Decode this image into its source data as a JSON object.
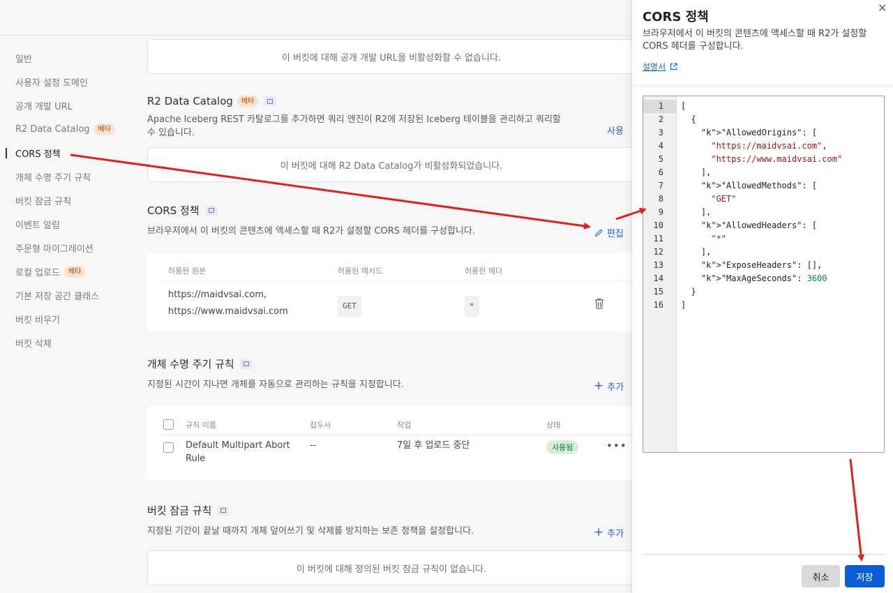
{
  "nav": {
    "items": [
      {
        "label": "일반"
      },
      {
        "label": "사용자 설정 도메인"
      },
      {
        "label": "공개 개발 URL"
      },
      {
        "label": "R2 Data Catalog",
        "badge": "베타"
      },
      {
        "label": "CORS 정책",
        "active": true
      },
      {
        "label": "개체 수명 주기 규칙"
      },
      {
        "label": "버킷 잠금 규칙"
      },
      {
        "label": "이벤트 알림"
      },
      {
        "label": "주문형 마이그레이션"
      },
      {
        "label": "로컬 업로드",
        "badge": "베타"
      },
      {
        "label": "기본 저장 공간 클래스"
      },
      {
        "label": "버킷 비우기"
      },
      {
        "label": "버킷 삭제"
      }
    ]
  },
  "main": {
    "public_url_box": "이 버킷에 대해 공개 개발 URL을 비활성화할 수 없습니다.",
    "catalog": {
      "title": "R2 Data Catalog",
      "badge": "베타",
      "desc_line1": "Apache Iceberg REST 카탈로그를 추가하면 쿼리 엔진이 R2에 저장된 Iceberg 테이블을 관리하고 쿼리할",
      "desc_line2": "수 있습니다.",
      "action": "사용",
      "empty": "이 버킷에 대해 R2 Data Catalog가 비활성화되었습니다."
    },
    "cors": {
      "title": "CORS 정책",
      "desc": "브라우저에서 이 버킷의 콘텐츠에 액세스할 때 R2가 설정할 CORS 헤더를 구성합니다.",
      "edit": "편집",
      "headers": [
        "허용된 원본",
        "허용된 메서드",
        "허용된 헤더"
      ],
      "row": {
        "origin1": "https://maidvsai.com,",
        "origin2": "https://www.maidvsai.com",
        "method": "GET",
        "header": "*"
      }
    },
    "lifecycle": {
      "title": "개체 수명 주기 규칙",
      "desc": "지정된 시간이 지나면 개체를 자동으로 관리하는 규칙을 지정합니다.",
      "add": "추가",
      "headers": [
        "규칙 이름",
        "접두사",
        "작업",
        "상태"
      ],
      "row": {
        "name1": "Default Multipart Abort",
        "name2": "Rule",
        "prefix": "--",
        "action": "7일 후 업로드 중단",
        "status": "사용됨",
        "more": "•••"
      }
    },
    "lock": {
      "title": "버킷 잠금 규칙",
      "desc": "지정된 기간이 끝날 때까지 개체 덮어쓰기 및 삭제를 방지하는 보존 정책을 설정합니다.",
      "add": "추가",
      "empty": "이 버킷에 대해 정의된 버킷 잠금 규칙이 없습니다."
    }
  },
  "drawer": {
    "title": "CORS 정책",
    "desc": "브라우저에서 이 버킷의 콘텐츠에 액세스할 때 R2가 설정할 CORS 헤더를 구성합니다.",
    "doc_link": "설명서",
    "close": "✕",
    "cancel": "취소",
    "save": "저장",
    "code_lines": [
      "[",
      "  {",
      "    \"AllowedOrigins\": [",
      "      \"https://maidvsai.com\",",
      "      \"https://www.maidvsai.com\"",
      "    ],",
      "    \"AllowedMethods\": [",
      "      \"GET\"",
      "    ],",
      "    \"AllowedHeaders\": [",
      "      \"*\"",
      "    ],",
      "    \"ExposeHeaders\": [],",
      "    \"MaxAgeSeconds\": 3600",
      "  }",
      "]"
    ],
    "line_numbers": [
      "1",
      "2",
      "3",
      "4",
      "5",
      "6",
      "7",
      "8",
      "9",
      "10",
      "11",
      "12",
      "13",
      "14",
      "15",
      "16"
    ]
  },
  "colors": {
    "accent": "#1f62d4",
    "save": "#0b5ed7",
    "arrow": "#e0201b",
    "beta_bg": "#fde2cc",
    "status_bg": "#d3f0dd"
  }
}
